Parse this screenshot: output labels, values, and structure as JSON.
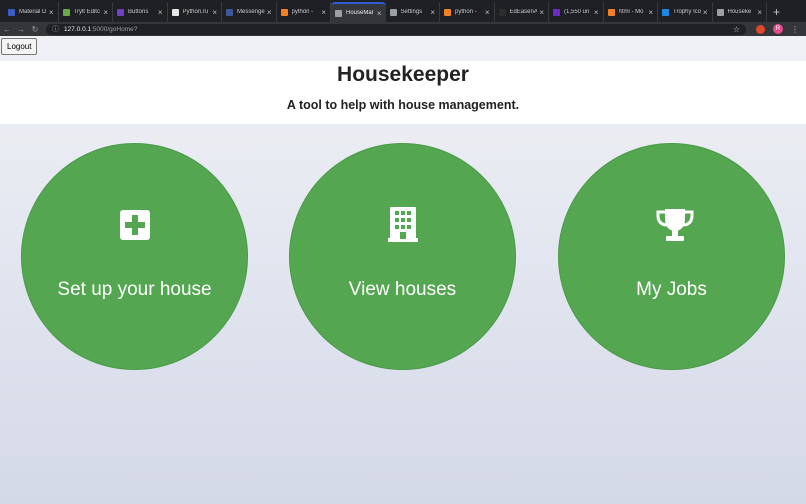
{
  "browser": {
    "tabs": [
      {
        "title": "Material D",
        "favicon_color": "#3b5cc4"
      },
      {
        "title": "Trylt Editc",
        "favicon_color": "#6aa84f"
      },
      {
        "title": "Buttons",
        "favicon_color": "#6f42c1"
      },
      {
        "title": "Python.ru",
        "favicon_color": "#e6e6e6"
      },
      {
        "title": "Messenge",
        "favicon_color": "#3b5998"
      },
      {
        "title": "python -",
        "favicon_color": "#f48024"
      },
      {
        "title": "HouseMar",
        "favicon_color": "#9aa0a6",
        "active": true
      },
      {
        "title": "Settings",
        "favicon_color": "#9aa0a6"
      },
      {
        "title": "python -",
        "favicon_color": "#f48024"
      },
      {
        "title": "EdEasenA",
        "favicon_color": "#2d2d2d"
      },
      {
        "title": "(1,550 un",
        "favicon_color": "#6c2cc4"
      },
      {
        "title": "html - Mo",
        "favicon_color": "#f48024"
      },
      {
        "title": "Trophy Ico",
        "favicon_color": "#1e88e5"
      },
      {
        "title": "Houseke",
        "favicon_color": "#9aa0a6"
      }
    ],
    "new_tab": "+",
    "url_host": "127.0.0.1",
    "url_path": ":5000/goHome?",
    "profile_initial": "R"
  },
  "page": {
    "logout_label": "Logout",
    "title": "Housekeeper",
    "subtitle": "A tool to help with house management.",
    "cards": [
      {
        "label": "Set up your house",
        "icon": "plus-square-icon"
      },
      {
        "label": "View houses",
        "icon": "building-icon"
      },
      {
        "label": "My Jobs",
        "icon": "trophy-icon"
      }
    ]
  },
  "colors": {
    "card_green": "#54a651",
    "header_bg": "#ffffff",
    "tab_accent": "#2f5dd6"
  }
}
